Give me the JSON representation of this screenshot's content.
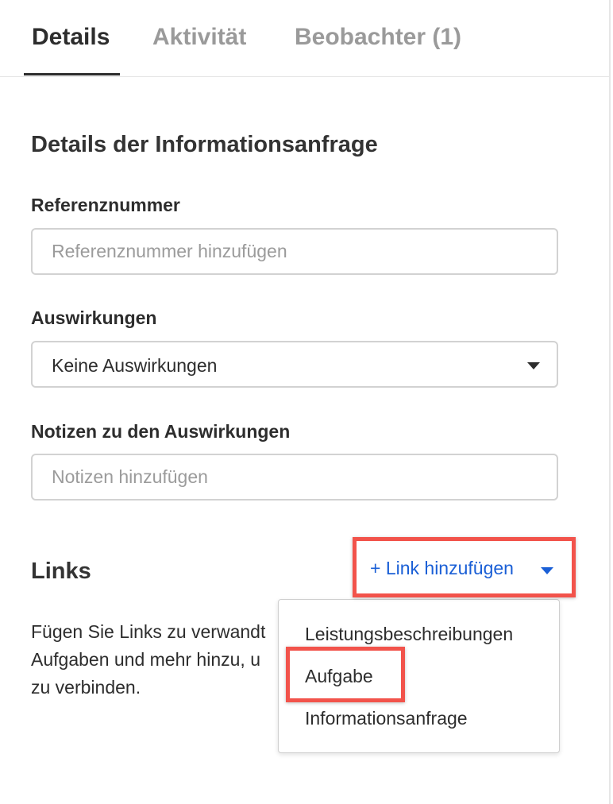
{
  "tabs": [
    {
      "label": "Details",
      "active": true
    },
    {
      "label": "Aktivität",
      "active": false
    },
    {
      "label": "Beobachter (1)",
      "active": false
    }
  ],
  "section_title": "Details der Informationsanfrage",
  "fields": {
    "reference": {
      "label": "Referenznummer",
      "placeholder": "Referenznummer hinzufügen",
      "value": ""
    },
    "impact": {
      "label": "Auswirkungen",
      "value": "Keine Auswirkungen"
    },
    "impact_notes": {
      "label": "Notizen zu den Auswirkungen",
      "placeholder": "Notizen hinzufügen",
      "value": ""
    }
  },
  "links": {
    "title": "Links",
    "description_lines": [
      "Fügen Sie Links zu verwandt",
      "Aufgaben und mehr hinzu, u",
      "zu verbinden."
    ],
    "add_button_label": "+ Link hinzufügen",
    "menu_items": [
      "Leistungsbeschreibungen",
      "Aufgabe",
      "Informationsanfrage"
    ]
  },
  "colors": {
    "accent": "#1a5fd6",
    "highlight": "#f2534b",
    "text": "#2d2d2d",
    "muted": "#9a9a9a"
  }
}
